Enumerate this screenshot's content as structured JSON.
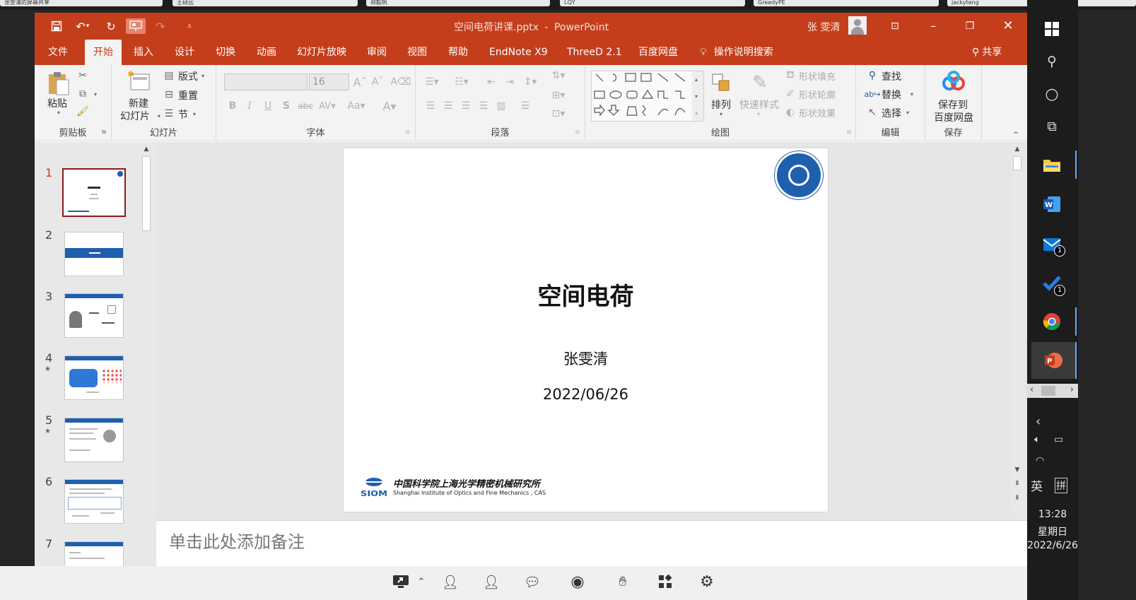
{
  "top_tasks": [
    "张雯清的屏幕共享",
    "王硕远",
    "郑毅帆",
    "LQY",
    "GreedyPE",
    "jackyteng"
  ],
  "title_bar": {
    "doc_title": "空间电荷讲课.pptx",
    "separator": "-",
    "app_name": "PowerPoint",
    "user_name": "张 雯清",
    "icons": [
      "save-icon",
      "undo-icon",
      "redo-icon",
      "present-icon",
      "redo-disabled-icon",
      "customize-icon"
    ]
  },
  "tabs": [
    "文件",
    "开始",
    "插入",
    "设计",
    "切换",
    "动画",
    "幻灯片放映",
    "审阅",
    "视图",
    "帮助",
    "EndNote X9",
    "ThreeD 2.1",
    "百度网盘"
  ],
  "active_tab": "开始",
  "tell_me": "操作说明搜索",
  "share": "共享",
  "ribbon": {
    "groups": [
      "剪贴板",
      "幻灯片",
      "字体",
      "段落",
      "绘图",
      "编辑",
      "保存"
    ],
    "clipboard": {
      "paste": "粘贴"
    },
    "slides": {
      "new_line1": "新建",
      "new_line2": "幻灯片",
      "layout": "版式",
      "reset": "重置",
      "section": "节"
    },
    "font": {
      "size": "16"
    },
    "drawing": {
      "arrange": "排列",
      "quick_styles": "快速样式",
      "shape_fill": "形状填充",
      "shape_outline": "形状轮廓",
      "shape_effects": "形状效果"
    },
    "editing": {
      "find": "查找",
      "replace": "替换",
      "select": "选择"
    },
    "save": {
      "line1": "保存到",
      "line2": "百度网盘"
    }
  },
  "thumbnails": [
    {
      "num": "1",
      "star": ""
    },
    {
      "num": "2",
      "star": ""
    },
    {
      "num": "3",
      "star": ""
    },
    {
      "num": "4",
      "star": "★"
    },
    {
      "num": "5",
      "star": "★"
    },
    {
      "num": "6",
      "star": ""
    },
    {
      "num": "7",
      "star": ""
    }
  ],
  "slide": {
    "title": "空间电荷",
    "author": "张雯清",
    "date": "2022/06/26",
    "org_cn": "中国科学院上海光学精密机械研究所",
    "org_en": "Shanghai Institute of Optics and Fine Mechanics , CAS",
    "org_abbr": "SIOM"
  },
  "notes_placeholder": "单击此处添加备注",
  "taskbar": {
    "mail_badge": "1",
    "todo_badge": "1",
    "ime": "英",
    "ime_mode": "拼",
    "time": "13:28",
    "weekday": "星期日",
    "date": "2022/6/26"
  },
  "colors": {
    "accent": "#c43e1c",
    "slide_blue": "#1f5fae",
    "taskbar": "#1c1c1c"
  }
}
